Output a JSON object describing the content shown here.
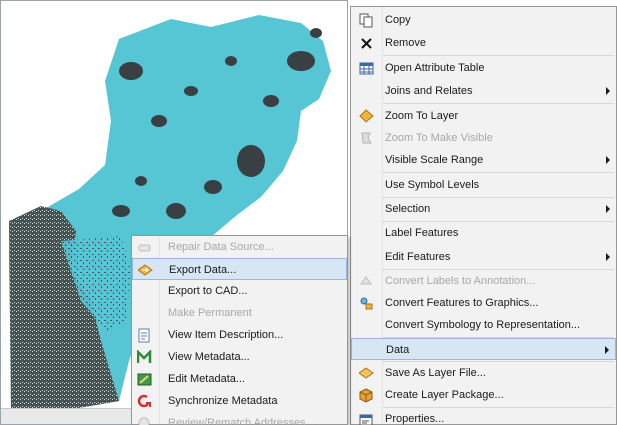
{
  "main_menu": {
    "items": [
      {
        "label": "Copy",
        "icon": "copy-icon",
        "disabled": false,
        "submenu": false
      },
      {
        "label": "Remove",
        "icon": "remove-icon",
        "disabled": false,
        "submenu": false
      },
      {
        "label": "Open Attribute Table",
        "icon": "table-icon",
        "disabled": false,
        "submenu": false
      },
      {
        "label": "Joins and Relates",
        "icon": "",
        "disabled": false,
        "submenu": true
      },
      {
        "label": "Zoom To Layer",
        "icon": "zoom-to-layer-icon",
        "disabled": false,
        "submenu": false
      },
      {
        "label": "Zoom To Make Visible",
        "icon": "zoom-visible-icon",
        "disabled": true,
        "submenu": false
      },
      {
        "label": "Visible Scale Range",
        "icon": "",
        "disabled": false,
        "submenu": true
      },
      {
        "label": "Use Symbol Levels",
        "icon": "",
        "disabled": false,
        "submenu": false
      },
      {
        "label": "Selection",
        "icon": "",
        "disabled": false,
        "submenu": true
      },
      {
        "label": "Label Features",
        "icon": "",
        "disabled": false,
        "submenu": false
      },
      {
        "label": "Edit Features",
        "icon": "",
        "disabled": false,
        "submenu": true
      },
      {
        "label": "Convert Labels to Annotation...",
        "icon": "annotation-icon",
        "disabled": true,
        "submenu": false
      },
      {
        "label": "Convert Features to Graphics...",
        "icon": "graphics-icon",
        "disabled": false,
        "submenu": false
      },
      {
        "label": "Convert Symbology to Representation...",
        "icon": "",
        "disabled": false,
        "submenu": false
      },
      {
        "label": "Data",
        "icon": "",
        "disabled": false,
        "submenu": true,
        "highlighted": true
      },
      {
        "label": "Save As Layer File...",
        "icon": "layer-file-icon",
        "disabled": false,
        "submenu": false
      },
      {
        "label": "Create Layer Package...",
        "icon": "layer-package-icon",
        "disabled": false,
        "submenu": false
      },
      {
        "label": "Properties...",
        "icon": "properties-icon",
        "disabled": false,
        "submenu": false
      }
    ]
  },
  "data_submenu": {
    "items": [
      {
        "label": "Repair Data Source...",
        "icon": "repair-icon",
        "disabled": true
      },
      {
        "label": "Export Data...",
        "icon": "export-data-icon",
        "disabled": false,
        "highlighted": true
      },
      {
        "label": "Export to CAD...",
        "icon": "",
        "disabled": false
      },
      {
        "label": "Make Permanent",
        "icon": "",
        "disabled": true
      },
      {
        "label": "View Item Description...",
        "icon": "description-icon",
        "disabled": false
      },
      {
        "label": "View Metadata...",
        "icon": "view-metadata-icon",
        "disabled": false
      },
      {
        "label": "Edit Metadata...",
        "icon": "edit-metadata-icon",
        "disabled": false
      },
      {
        "label": "Synchronize Metadata",
        "icon": "sync-metadata-icon",
        "disabled": false
      },
      {
        "label": "Review/Rematch Addresses...",
        "icon": "rematch-icon",
        "disabled": true
      }
    ]
  },
  "colors": {
    "map_fill": "#56c5d4",
    "map_dark": "#3a3f44",
    "highlight": "#d6e6f5",
    "highlight_border": "#98b9dd"
  }
}
